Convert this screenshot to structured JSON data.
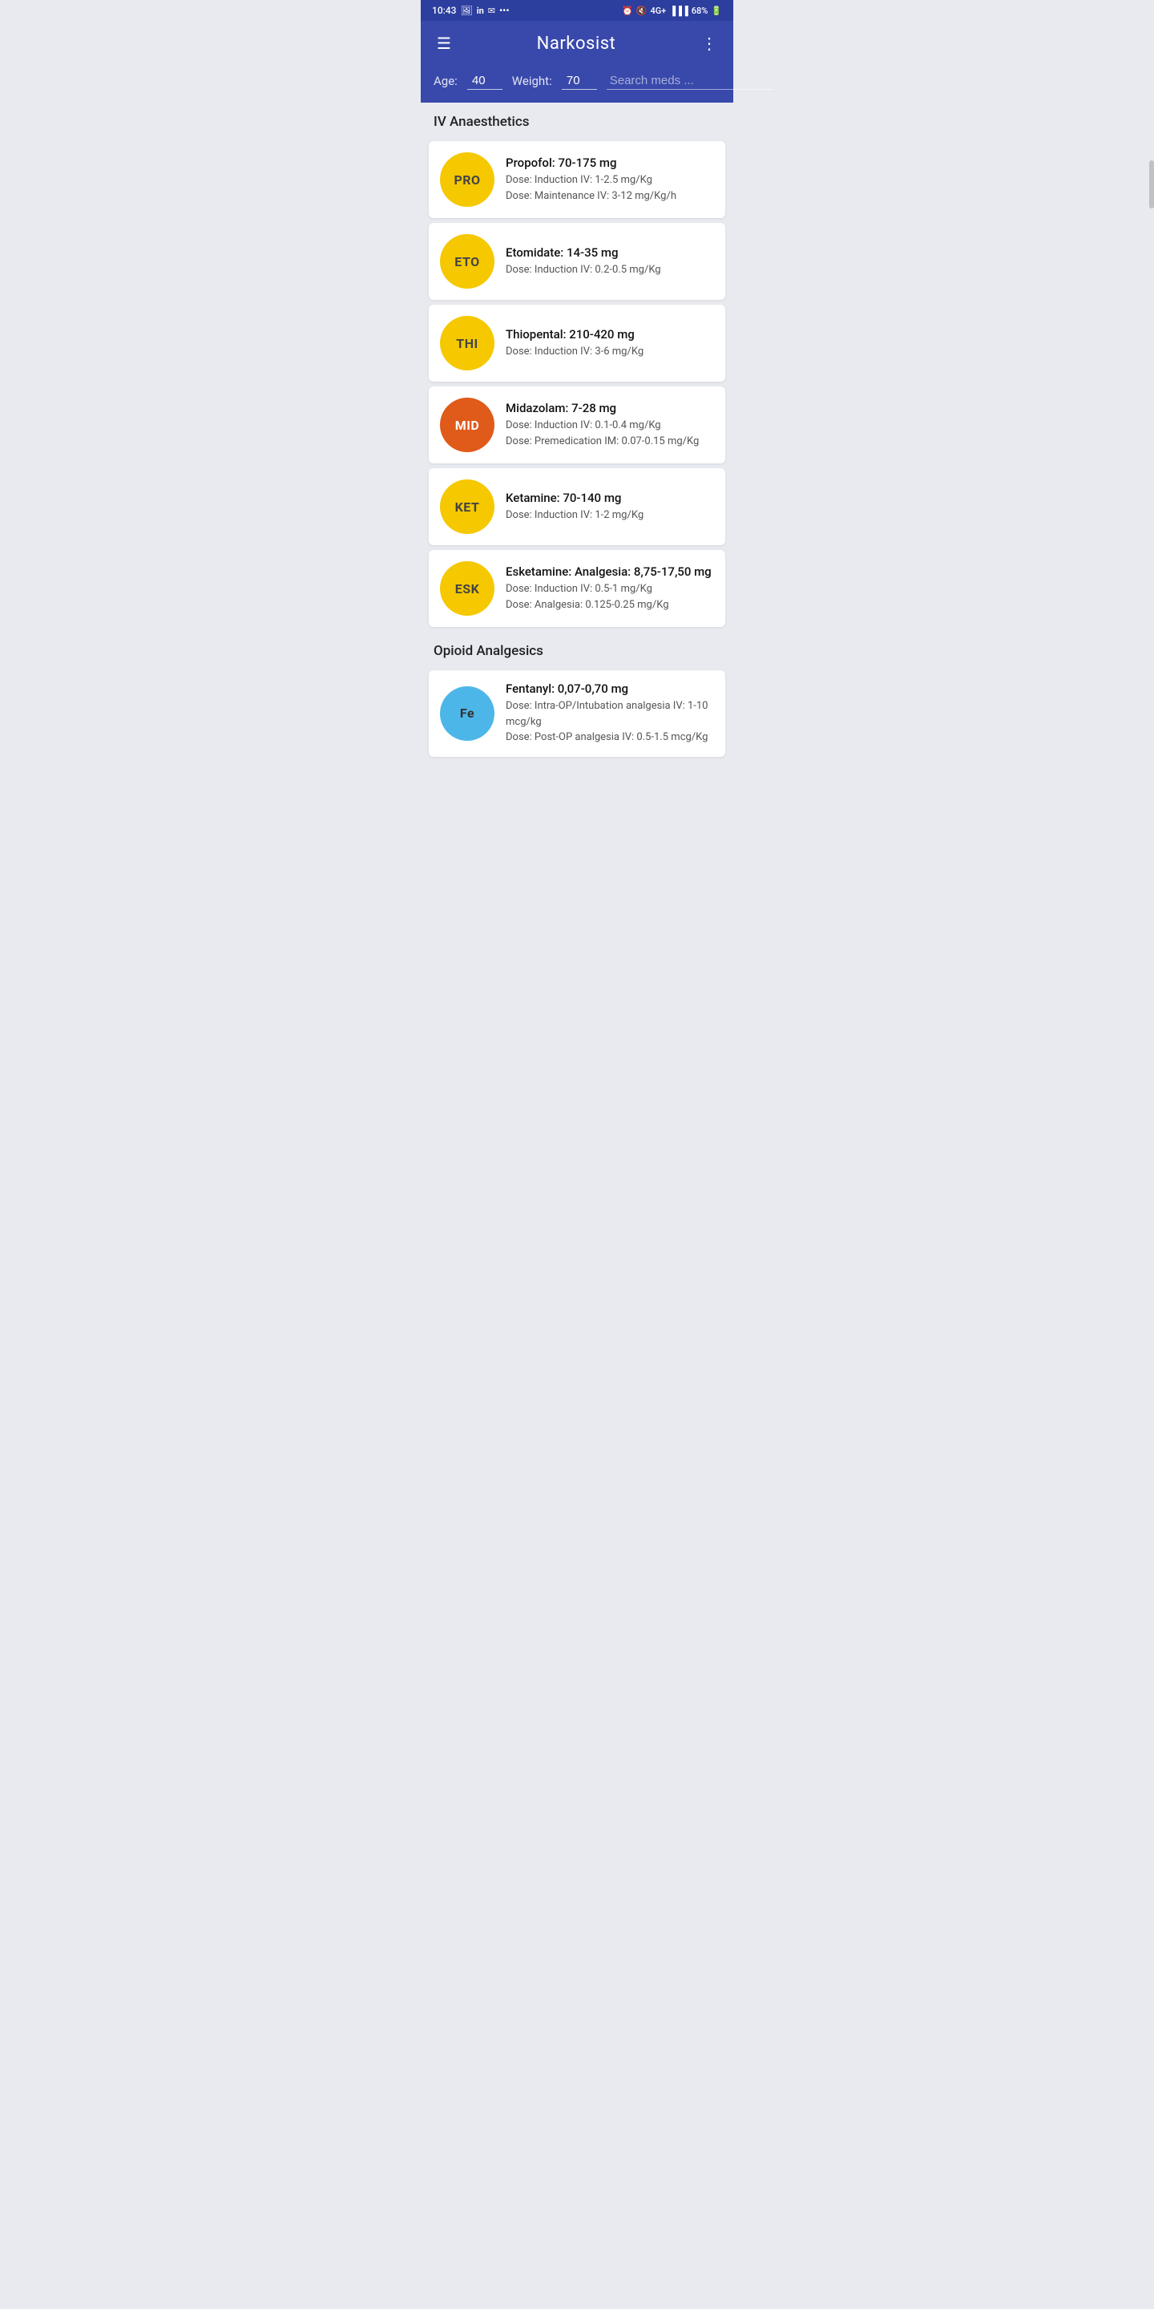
{
  "statusBar": {
    "time": "10:43",
    "battery": "68%",
    "network": "4G+"
  },
  "appBar": {
    "title": "Narkosist",
    "menuIcon": "☰",
    "moreIcon": "⋮"
  },
  "subHeader": {
    "ageLabel": "Age:",
    "ageValue": "40",
    "weightLabel": "Weight:",
    "weightValue": "70",
    "searchPlaceholder": "Search meds ..."
  },
  "sections": [
    {
      "id": "iv-anaesthetics",
      "title": "IV Anaesthetics",
      "items": [
        {
          "id": "propofol",
          "abbreviation": "PRO",
          "badgeClass": "badge-yellow",
          "title": "Propofol: 70-175 mg",
          "doses": [
            "Dose: Induction IV: 1-2.5 mg/Kg",
            "Dose: Maintenance IV: 3-12 mg/Kg/h"
          ]
        },
        {
          "id": "etomidate",
          "abbreviation": "ETO",
          "badgeClass": "badge-yellow",
          "title": "Etomidate: 14-35 mg",
          "doses": [
            "Dose: Induction IV: 0.2-0.5 mg/Kg"
          ]
        },
        {
          "id": "thiopental",
          "abbreviation": "THI",
          "badgeClass": "badge-yellow",
          "title": "Thiopental: 210-420 mg",
          "doses": [
            "Dose: Induction IV: 3-6 mg/Kg"
          ]
        },
        {
          "id": "midazolam",
          "abbreviation": "MID",
          "badgeClass": "badge-orange",
          "title": "Midazolam: 7-28 mg",
          "doses": [
            "Dose: Induction IV: 0.1-0.4 mg/Kg",
            "Dose: Premedication IM: 0.07-0.15 mg/Kg"
          ]
        },
        {
          "id": "ketamine",
          "abbreviation": "KET",
          "badgeClass": "badge-yellow",
          "title": "Ketamine: 70-140 mg",
          "doses": [
            "Dose: Induction IV: 1-2 mg/Kg"
          ]
        },
        {
          "id": "esketamine",
          "abbreviation": "ESK",
          "badgeClass": "badge-yellow",
          "title": "Esketamine: Analgesia: 8,75-17,50 mg",
          "doses": [
            "Dose: Induction IV: 0.5-1 mg/Kg",
            "Dose: Analgesia: 0.125-0.25 mg/Kg"
          ]
        }
      ]
    },
    {
      "id": "opioid-analgesics",
      "title": "Opioid Analgesics",
      "items": [
        {
          "id": "fentanyl",
          "abbreviation": "Fe",
          "badgeClass": "badge-blue",
          "title": "Fentanyl: 0,07-0,70 mg",
          "doses": [
            "Dose: Intra-OP/Intubation analgesia IV: 1-10 mcg/kg",
            "Dose: Post-OP analgesia IV: 0.5-1.5 mcg/Kg"
          ]
        }
      ]
    }
  ]
}
